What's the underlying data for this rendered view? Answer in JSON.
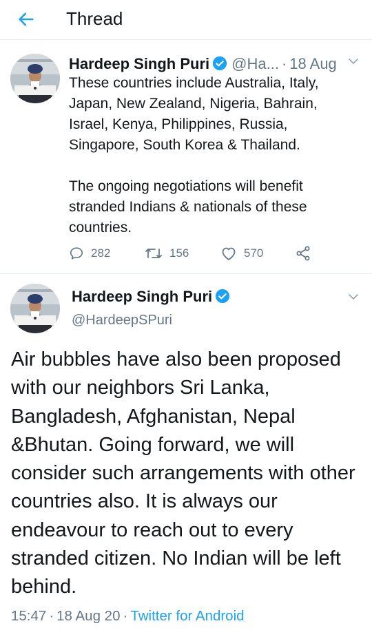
{
  "colors": {
    "accent": "#1da1f2",
    "text": "#14171a",
    "secondary": "#657786",
    "divider": "#e6ecf0"
  },
  "header": {
    "title": "Thread",
    "back_icon": "arrow-left-icon"
  },
  "tweet1": {
    "name": "Hardeep Singh Puri",
    "handle": "@Ha...",
    "time": "18 Aug",
    "paragraph1": "These countries include Australia, Italy, Japan, New Zealand, Nigeria, Bahrain, Israel, Kenya, Philippines, Russia, Singapore, South Korea & Thailand.",
    "paragraph2": "The ongoing negotiations will benefit stranded Indians & nationals of these countries.",
    "replies": "282",
    "retweets": "156",
    "likes": "570"
  },
  "tweet2": {
    "name": "Hardeep Singh Puri",
    "handle": "@HardeepSPuri",
    "text": "Air bubbles have also been proposed with our neighbors Sri Lanka, Bangladesh, Afghanistan, Nepal &Bhutan. Going forward, we will consider such arrangements with other countries also. It is always our endeavour to reach out to every stranded citizen. No Indian will be left behind.",
    "time": "15:47",
    "date": "18 Aug 20",
    "source": "Twitter for Android"
  }
}
